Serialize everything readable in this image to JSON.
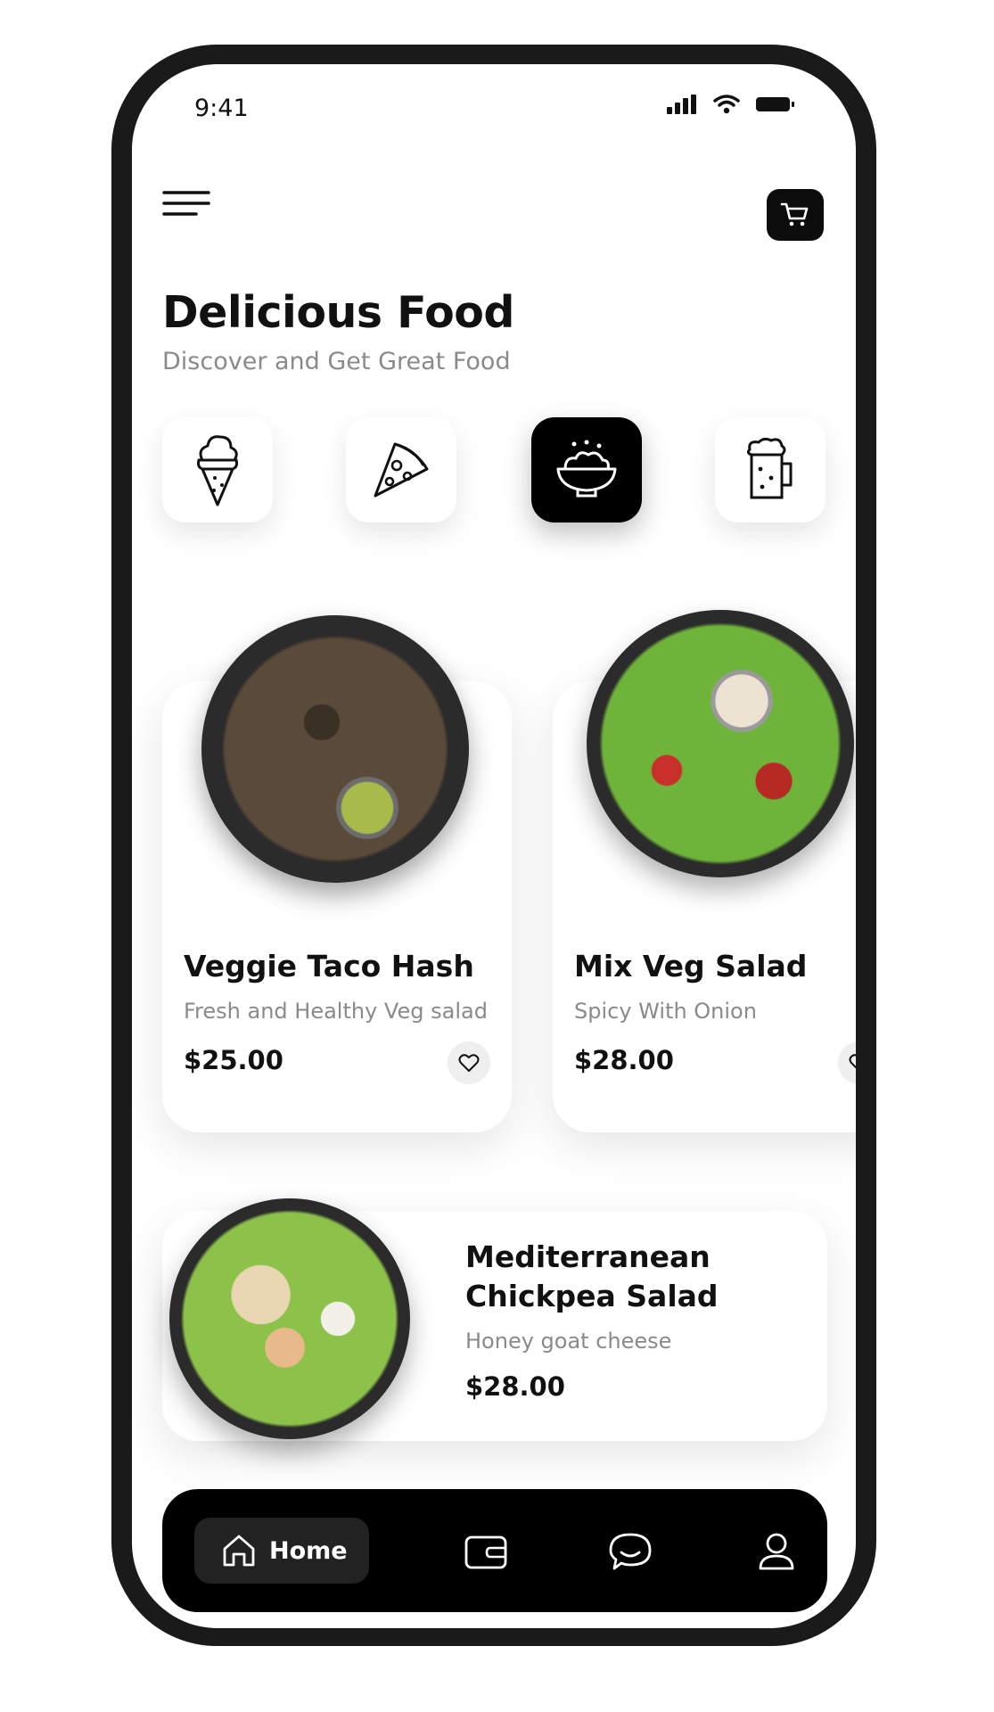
{
  "status_bar": {
    "time": "9:41"
  },
  "header": {
    "title": "Delicious Food",
    "subtitle": "Discover and Get Great Food"
  },
  "categories": [
    {
      "icon": "ice-cream-icon",
      "active": false
    },
    {
      "icon": "pizza-slice-icon",
      "active": false
    },
    {
      "icon": "salad-bowl-icon",
      "active": true
    },
    {
      "icon": "beer-mug-icon",
      "active": false
    }
  ],
  "featured": [
    {
      "name": "Veggie Taco Hash",
      "description": "Fresh and Healthy Veg salad",
      "price": "$25.00"
    },
    {
      "name": "Mix Veg Salad",
      "description": "Spicy With Onion",
      "price": "$28.00"
    }
  ],
  "popular": {
    "name_line1": "Mediterranean",
    "name_line2": "Chickpea Salad",
    "description": "Honey goat cheese",
    "price": "$28.00"
  },
  "bottom_nav": {
    "home_label": "Home",
    "items": [
      "home-icon",
      "wallet-icon",
      "chat-icon",
      "profile-icon"
    ]
  },
  "colors": {
    "accent": "#000000",
    "background": "#ffffff",
    "muted_text": "#8a8a8a"
  }
}
